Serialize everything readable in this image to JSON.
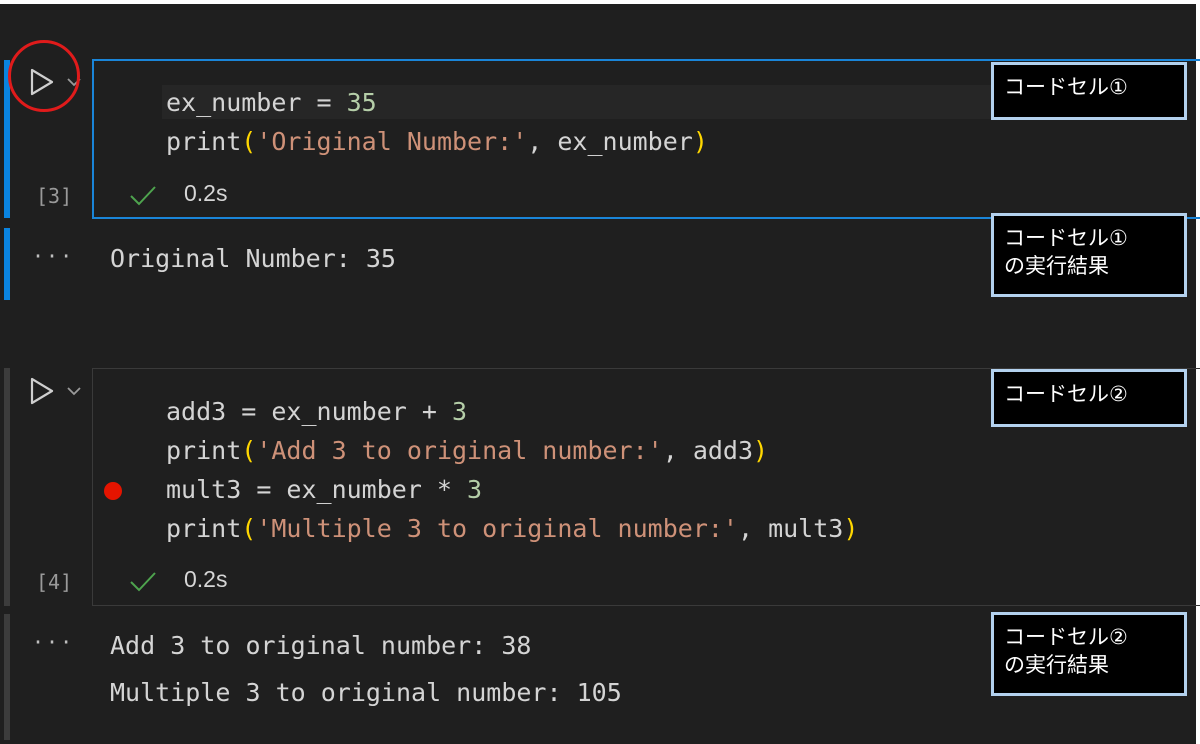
{
  "cell1": {
    "exec_count": "[3]",
    "code": {
      "l1_var": "ex_number",
      "l1_op": " = ",
      "l1_num": "35",
      "l2_fn": "print",
      "l2_open": "(",
      "l2_str": "'Original Number:'",
      "l2_sep": ", ",
      "l2_arg": "ex_number",
      "l2_close": ")"
    },
    "status_time": "0.2s",
    "output_more": "···",
    "output": [
      "Original Number: 35"
    ]
  },
  "cell2": {
    "exec_count": "[4]",
    "code": {
      "l1_var": "add3",
      "l1_mid": " = ex_number + ",
      "l1_num": "3",
      "l2_fn": "print",
      "l2_open": "(",
      "l2_str": "'Add 3 to original number:'",
      "l2_sep": ", ",
      "l2_arg": "add3",
      "l2_close": ")",
      "l3_var": "mult3",
      "l3_mid": " = ex_number * ",
      "l3_num": "3",
      "l4_fn": "print",
      "l4_open": "(",
      "l4_str": "'Multiple 3 to original number:'",
      "l4_sep": ", ",
      "l4_arg": "mult3",
      "l4_close": ")"
    },
    "status_time": "0.2s",
    "output_more": "···",
    "output": [
      "Add 3 to original number: 38",
      "Multiple 3 to original number: 105"
    ]
  },
  "annotations": {
    "code_cell_1": "コードセル①",
    "result_1_l1": "コードセル①",
    "result_1_l2": "の実行結果",
    "code_cell_2": "コードセル②",
    "result_2_l1": "コードセル②",
    "result_2_l2": "の実行結果"
  },
  "icons": {
    "run": "play-triangle-icon",
    "run_menu": "chevron-down-icon",
    "success": "check-icon",
    "breakpoint": "breakpoint-dot"
  },
  "colors": {
    "accent": "#0a84e0",
    "highlight_circle": "#e01b1b",
    "string": "#ce9178",
    "number": "#b5cea8",
    "bracket": "#ffd700",
    "breakpoint": "#e51400"
  }
}
